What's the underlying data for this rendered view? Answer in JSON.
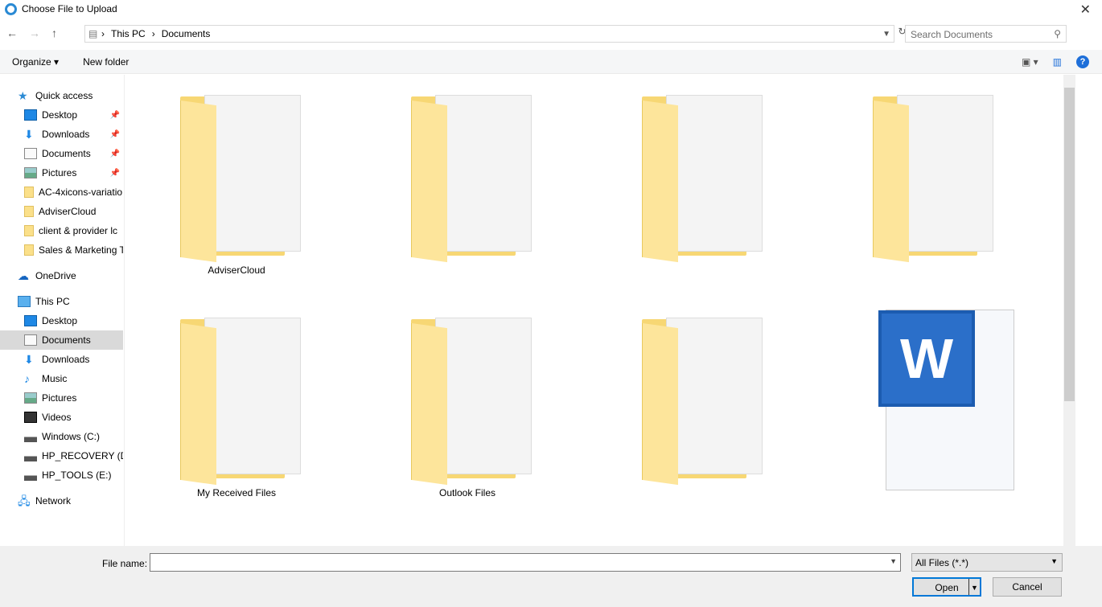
{
  "window": {
    "title": "Choose File to Upload"
  },
  "address": {
    "crumbs": [
      "This PC",
      "Documents"
    ],
    "search_placeholder": "Search Documents"
  },
  "toolbar": {
    "organize": "Organize ▾",
    "new_folder": "New folder",
    "help": "?"
  },
  "sidebar": {
    "items": [
      {
        "label": "Quick access",
        "icon": "star-icon",
        "level": 0,
        "pinned": false
      },
      {
        "label": "Desktop",
        "icon": "desktop-icon",
        "level": 1,
        "pinned": true
      },
      {
        "label": "Downloads",
        "icon": "download-icon",
        "level": 1,
        "pinned": true
      },
      {
        "label": "Documents",
        "icon": "document-icon",
        "level": 1,
        "pinned": true
      },
      {
        "label": "Pictures",
        "icon": "pictures-icon",
        "level": 1,
        "pinned": true
      },
      {
        "label": "AC-4xicons-variatio",
        "icon": "folder-icon",
        "level": 1
      },
      {
        "label": "AdviserCloud",
        "icon": "folder-icon",
        "level": 1
      },
      {
        "label": "client  & provider lc",
        "icon": "folder-icon",
        "level": 1
      },
      {
        "label": "Sales & Marketing T",
        "icon": "folder-icon",
        "level": 1
      },
      {
        "label": "OneDrive",
        "icon": "cloud-icon",
        "level": 0
      },
      {
        "label": "This PC",
        "icon": "computer-icon",
        "level": 0
      },
      {
        "label": "Desktop",
        "icon": "desktop-icon",
        "level": 1
      },
      {
        "label": "Documents",
        "icon": "document-icon",
        "level": 1,
        "selected": true
      },
      {
        "label": "Downloads",
        "icon": "download-icon",
        "level": 1
      },
      {
        "label": "Music",
        "icon": "music-icon",
        "level": 1
      },
      {
        "label": "Pictures",
        "icon": "pictures-icon",
        "level": 1
      },
      {
        "label": "Videos",
        "icon": "video-icon",
        "level": 1
      },
      {
        "label": "Windows (C:)",
        "icon": "drive-icon",
        "level": 1
      },
      {
        "label": "HP_RECOVERY (D:)",
        "icon": "drive-icon",
        "level": 1
      },
      {
        "label": "HP_TOOLS (E:)",
        "icon": "drive-icon",
        "level": 1
      },
      {
        "label": "Network",
        "icon": "network-icon",
        "level": 0
      }
    ]
  },
  "files": [
    {
      "label": "AdviserCloud",
      "type": "folder"
    },
    {
      "label": "",
      "type": "folder"
    },
    {
      "label": "",
      "type": "folder"
    },
    {
      "label": "",
      "type": "folder"
    },
    {
      "label": "My Received Files",
      "type": "folder"
    },
    {
      "label": "Outlook Files",
      "type": "folder"
    },
    {
      "label": "",
      "type": "folder"
    },
    {
      "label": "",
      "type": "word-document"
    }
  ],
  "bottom": {
    "file_name_label": "File name:",
    "file_name_value": "",
    "file_type": "All Files (*.*)",
    "open": "Open",
    "cancel": "Cancel"
  }
}
